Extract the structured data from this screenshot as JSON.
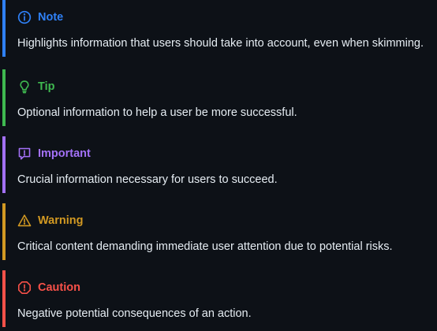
{
  "alerts": [
    {
      "type": "note",
      "title": "Note",
      "icon": "info-circle-icon",
      "color": "#2f81f7",
      "text": "Highlights information that users should take into account, even when skimming."
    },
    {
      "type": "tip",
      "title": "Tip",
      "icon": "lightbulb-icon",
      "color": "#3fb950",
      "text": "Optional information to help a user be more successful."
    },
    {
      "type": "important",
      "title": "Important",
      "icon": "report-icon",
      "color": "#a371f7",
      "text": "Crucial information necessary for users to succeed."
    },
    {
      "type": "warning",
      "title": "Warning",
      "icon": "alert-triangle-icon",
      "color": "#d29922",
      "text": "Critical content demanding immediate user attention due to potential risks."
    },
    {
      "type": "caution",
      "title": "Caution",
      "icon": "stop-icon",
      "color": "#f85149",
      "text": "Negative potential consequences of an action."
    }
  ]
}
